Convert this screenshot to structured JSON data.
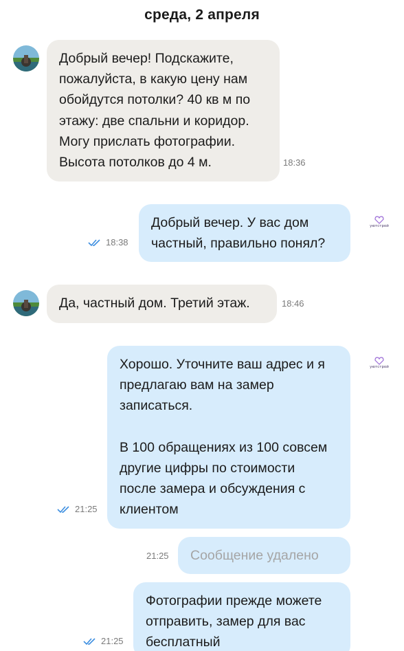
{
  "date_header": "среда, 2 апреля",
  "brand": {
    "name": "уютстрой",
    "accent": "#9b6bd6"
  },
  "colors": {
    "incoming_bubble": "#efede9",
    "outgoing_bubble": "#d7ecfc",
    "read_check": "#3c8ee0"
  },
  "messages": [
    {
      "direction": "incoming",
      "lines": [
        "Добрый вечер! Подскажите,",
        "пожалуйста, в какую цену нам",
        "обойдутся потолки? 40 кв м по",
        "этажу: две спальни и коридор.",
        "Могу прислать фотографии.",
        "Высота потолков до 4 м."
      ],
      "time": "18:36"
    },
    {
      "direction": "outgoing",
      "lines": [
        "Добрый вечер. У вас дом",
        "частный, правильно понял?"
      ],
      "time": "18:38",
      "status": "read"
    },
    {
      "direction": "incoming",
      "lines": [
        "Да, частный дом. Третий этаж."
      ],
      "time": "18:46"
    },
    {
      "direction": "outgoing",
      "lines": [
        "Хорошо. Уточните ваш адрес и я",
        "предлагаю вам на замер",
        "записаться.",
        "",
        "В 100 обращениях из 100 совсем",
        "другие цифры по стоимости",
        "после замера и обсуждения с",
        "клиентом"
      ],
      "time": "21:25",
      "status": "read"
    },
    {
      "direction": "outgoing",
      "deleted": true,
      "lines": [
        "Сообщение удалено"
      ],
      "time": "21:25"
    },
    {
      "direction": "outgoing",
      "lines": [
        "Фотографии прежде можете",
        "отправить, замер для вас",
        "бесплатный"
      ],
      "time": "21:25",
      "status": "read"
    }
  ]
}
